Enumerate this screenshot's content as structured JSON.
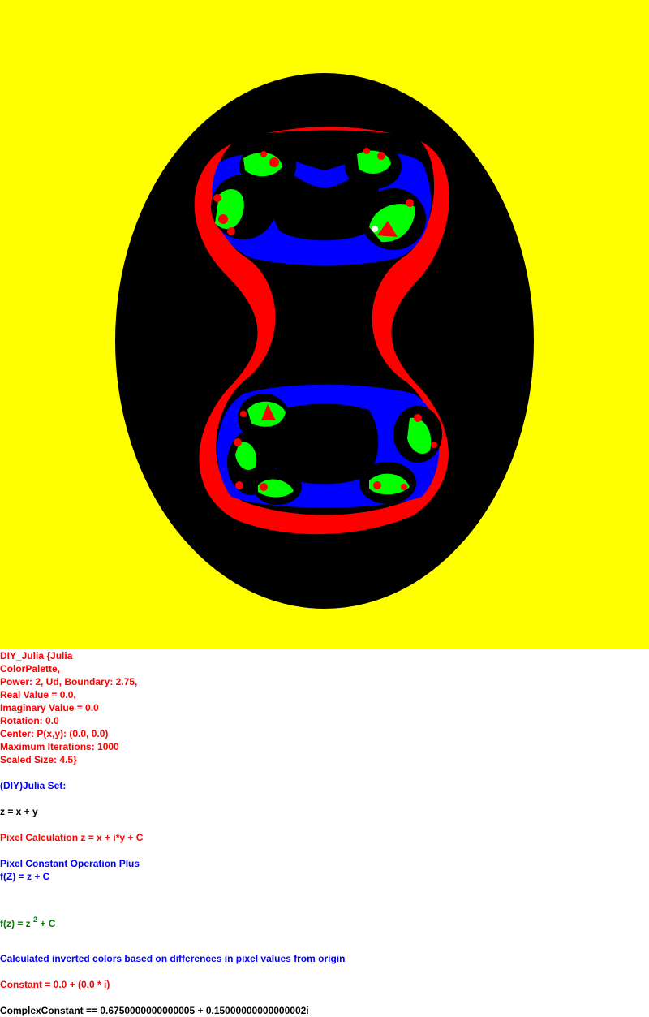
{
  "fractal": {
    "title": "DIY_Julia",
    "colors": {
      "outer": "#ffff00",
      "ring": "#000000",
      "band": "#ff0000",
      "inner": "#000000",
      "blue": "#0000ff",
      "green": "#00ff00",
      "white": "#ffffff"
    }
  },
  "params": {
    "line1": "DIY_Julia {Julia",
    "line2": "ColorPalette,",
    "line3": "Power: 2, Ud, Boundary: 2.75,",
    "line4": "Real Value = 0.0,",
    "line5": "Imaginary Value = 0.0",
    "line6": "Rotation: 0.0",
    "line7": "Center: P(x,y): (0.0, 0.0)",
    "line8": "Maximum Iterations: 1000",
    "line9": "Scaled Size: 4.5}"
  },
  "info": {
    "set_title": "(DIY)Julia Set:",
    "z_def": "z = x + y",
    "pixel_calc": "Pixel Calculation z = x + i*y + C",
    "pixel_op": "Pixel Constant Operation Plus",
    "fz_plus": "f(Z) = z + C",
    "fz_base": "f(z) = z ",
    "fz_exp": "2",
    "fz_tail": " + C",
    "colors_note": "Calculated inverted colors based on differences in pixel values from origin",
    "constant": "Constant = 0.0 + (0.0 * i)",
    "complex_constant": "ComplexConstant == 0.6750000000000005 + 0.15000000000000002i"
  }
}
